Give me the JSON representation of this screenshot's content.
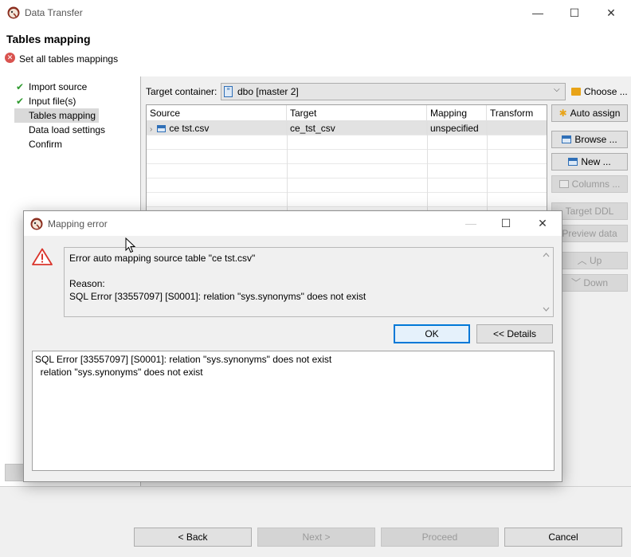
{
  "window": {
    "title": "Data Transfer",
    "min_glyph": "—",
    "max_glyph": "☐",
    "close_glyph": "✕"
  },
  "header": {
    "title": "Tables mapping",
    "subtitle": "Set all tables mappings"
  },
  "nav": {
    "items": [
      {
        "label": "Import source",
        "done": true
      },
      {
        "label": "Input file(s)",
        "done": true
      },
      {
        "label": "Tables mapping",
        "done": false,
        "selected": true
      },
      {
        "label": "Data load settings",
        "done": false
      },
      {
        "label": "Confirm",
        "done": false
      }
    ]
  },
  "target_container": {
    "label": "Target container:",
    "value": "dbo  [master 2]",
    "choose_label": "Choose ..."
  },
  "table": {
    "columns": [
      "Source",
      "Target",
      "Mapping",
      "Transform"
    ],
    "rows": [
      {
        "source": "ce tst.csv",
        "target": "ce_tst_csv",
        "mapping": "unspecified",
        "transform": ""
      }
    ]
  },
  "side_buttons": {
    "auto_assign": "Auto assign",
    "browse": "Browse ...",
    "new": "New ...",
    "columns": "Columns ...",
    "target_ddl": "Target DDL",
    "preview": "Preview data",
    "up": "Up",
    "down": "Down"
  },
  "footer": {
    "back": "< Back",
    "next": "Next >",
    "proceed": "Proceed",
    "cancel": "Cancel"
  },
  "dialog": {
    "title": "Mapping error",
    "message_line1": "Error auto mapping source table \"ce tst.csv\"",
    "message_line2": "Reason:",
    "message_line3": "SQL Error [33557097] [S0001]: relation \"sys.synonyms\" does not exist",
    "ok_label": "OK",
    "details_label": "<< Details",
    "details_line1": "SQL Error [33557097] [S0001]: relation \"sys.synonyms\" does not exist",
    "details_line2": "  relation \"sys.synonyms\" does not exist"
  },
  "colors": {
    "accent": "#0078d7",
    "check": "#2e9a2e",
    "error": "#d9534f",
    "warning": "#d9342b"
  }
}
